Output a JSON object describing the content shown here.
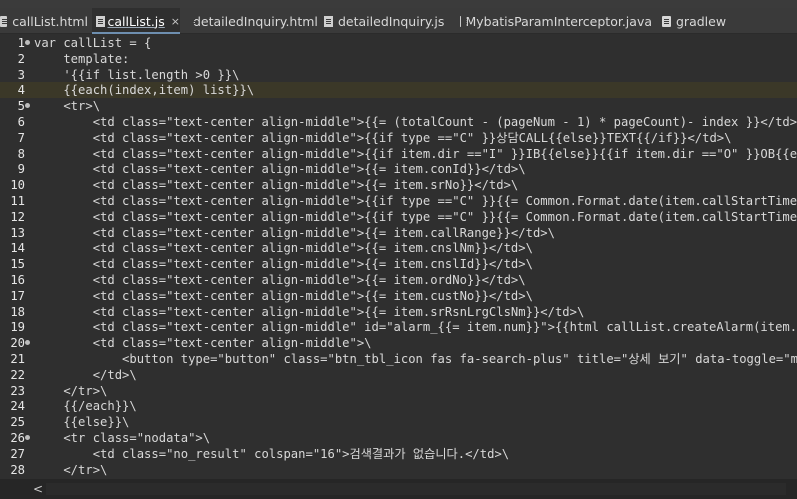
{
  "tabs": [
    {
      "label": "callList.html",
      "icon": "html-file-icon",
      "active": false
    },
    {
      "label": "callList.js",
      "icon": "js-file-icon",
      "active": true,
      "close": "×"
    },
    {
      "label": "detailedInquiry.html",
      "icon": "html-file-icon",
      "active": false
    },
    {
      "label": "detailedInquiry.js",
      "icon": "js-file-icon",
      "active": false
    },
    {
      "label": "MybatisParamInterceptor.java",
      "icon": "java-file-icon",
      "active": false
    },
    {
      "label": "gradlew",
      "icon": "file-icon",
      "active": false
    }
  ],
  "current_line": 4,
  "lines": [
    {
      "n": "1",
      "fold": true,
      "text": "var callList = {"
    },
    {
      "n": "2",
      "fold": false,
      "text": "    template:"
    },
    {
      "n": "3",
      "fold": false,
      "text": "    '{{if list.length >0 }}\\"
    },
    {
      "n": "4",
      "fold": false,
      "text": "    {{each(index,item) list}}\\"
    },
    {
      "n": "5",
      "fold": true,
      "text": "    <tr>\\"
    },
    {
      "n": "6",
      "fold": false,
      "text": "        <td class=\"text-center align-middle\">{{= (totalCount - (pageNum - 1) * pageCount)- index }}</td>\\"
    },
    {
      "n": "7",
      "fold": false,
      "text": "        <td class=\"text-center align-middle\">{{if type ==\"C\" }}상담CALL{{else}}TEXT{{/if}}</td>\\"
    },
    {
      "n": "8",
      "fold": false,
      "text": "        <td class=\"text-center align-middle\">{{if item.dir ==\"I\" }}IB{{else}}{{if item.dir ==\"O\" }}OB{{else"
    },
    {
      "n": "9",
      "fold": false,
      "text": "        <td class=\"text-center align-middle\">{{= item.conId}}</td>\\"
    },
    {
      "n": "10",
      "fold": false,
      "text": "        <td class=\"text-center align-middle\">{{= item.srNo}}</td>\\"
    },
    {
      "n": "11",
      "fold": false,
      "text": "        <td class=\"text-center align-middle\">{{if type ==\"C\" }}{{= Common.Format.date(item.callStartTime,\""
    },
    {
      "n": "12",
      "fold": false,
      "text": "        <td class=\"text-center align-middle\">{{if type ==\"C\" }}{{= Common.Format.date(item.callStartTime,\""
    },
    {
      "n": "13",
      "fold": false,
      "text": "        <td class=\"text-center align-middle\">{{= item.callRange}}</td>\\"
    },
    {
      "n": "14",
      "fold": false,
      "text": "        <td class=\"text-center align-middle\">{{= item.cnslNm}}</td>\\"
    },
    {
      "n": "15",
      "fold": false,
      "text": "        <td class=\"text-center align-middle\">{{= item.cnslId}}</td>\\"
    },
    {
      "n": "16",
      "fold": false,
      "text": "        <td class=\"text-center align-middle\">{{= item.ordNo}}</td>\\"
    },
    {
      "n": "17",
      "fold": false,
      "text": "        <td class=\"text-center align-middle\">{{= item.custNo}}</td>\\"
    },
    {
      "n": "18",
      "fold": false,
      "text": "        <td class=\"text-center align-middle\">{{= item.srRsnLrgClsNm}}</td>\\"
    },
    {
      "n": "19",
      "fold": false,
      "text": "        <td class=\"text-center align-middle\" id=\"alarm_{{= item.num}}\">{{html callList.createAlarm(item.al"
    },
    {
      "n": "20",
      "fold": true,
      "text": "        <td class=\"text-center align-middle\">\\"
    },
    {
      "n": "21",
      "fold": false,
      "text": "            <button type=\"button\" class=\"btn_tbl_icon fas fa-search-plus\" title=\"상세 보기\" data-toggle=\"moda"
    },
    {
      "n": "22",
      "fold": false,
      "text": "        </td>\\"
    },
    {
      "n": "23",
      "fold": false,
      "text": "    </tr>\\"
    },
    {
      "n": "24",
      "fold": false,
      "text": "    {{/each}}\\"
    },
    {
      "n": "25",
      "fold": false,
      "text": "    {{else}}\\"
    },
    {
      "n": "26",
      "fold": true,
      "text": "    <tr class=\"nodata\">\\"
    },
    {
      "n": "27",
      "fold": false,
      "text": "        <td class=\"no_result\" colspan=\"16\">검색결과가 없습니다.</td>\\"
    },
    {
      "n": "28",
      "fold": false,
      "text": "    </tr>\\"
    }
  ],
  "scrollbar": {
    "left_arrow": "<"
  }
}
